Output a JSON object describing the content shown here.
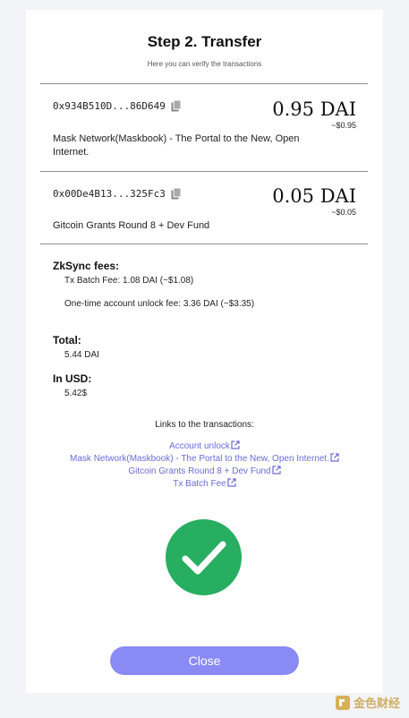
{
  "header": {
    "title": "Step 2. Transfer",
    "subtitle": "Here you can verify the transactions"
  },
  "transactions": [
    {
      "address": "0x934B510D...86D649",
      "amount": "0.95 DAI",
      "usd": "~$0.95",
      "description": "Mask Network(Maskbook) - The Portal to the New, Open Internet."
    },
    {
      "address": "0x00De4B13...325Fc3",
      "amount": "0.05 DAI",
      "usd": "~$0.05",
      "description": "Gitcoin Grants Round 8 + Dev Fund"
    }
  ],
  "fees": {
    "heading": "ZkSync fees:",
    "batch_fee": "Tx Batch Fee: 1.08 DAI (~$1.08)",
    "unlock_fee": "One-time account unlock fee: 3.36 DAI (~$3.35)"
  },
  "total": {
    "heading": "Total:",
    "value": "5.44 DAI"
  },
  "usd_total": {
    "heading": "In USD:",
    "value": "5.42$"
  },
  "links": {
    "heading": "Links to the transactions:",
    "items": [
      "Account unlock",
      "Mask Network(Maskbook) - The Portal to the New, Open Internet.",
      "Gitcoin Grants Round 8 + Dev Fund",
      "Tx Batch Fee"
    ]
  },
  "status_icon": "checkmark-success-icon",
  "close_label": "Close",
  "watermark": "金色财经",
  "colors": {
    "link": "#6b6bd6",
    "button": "#8a8af5",
    "success": "#27ae60",
    "divider": "#8f8f8f"
  }
}
